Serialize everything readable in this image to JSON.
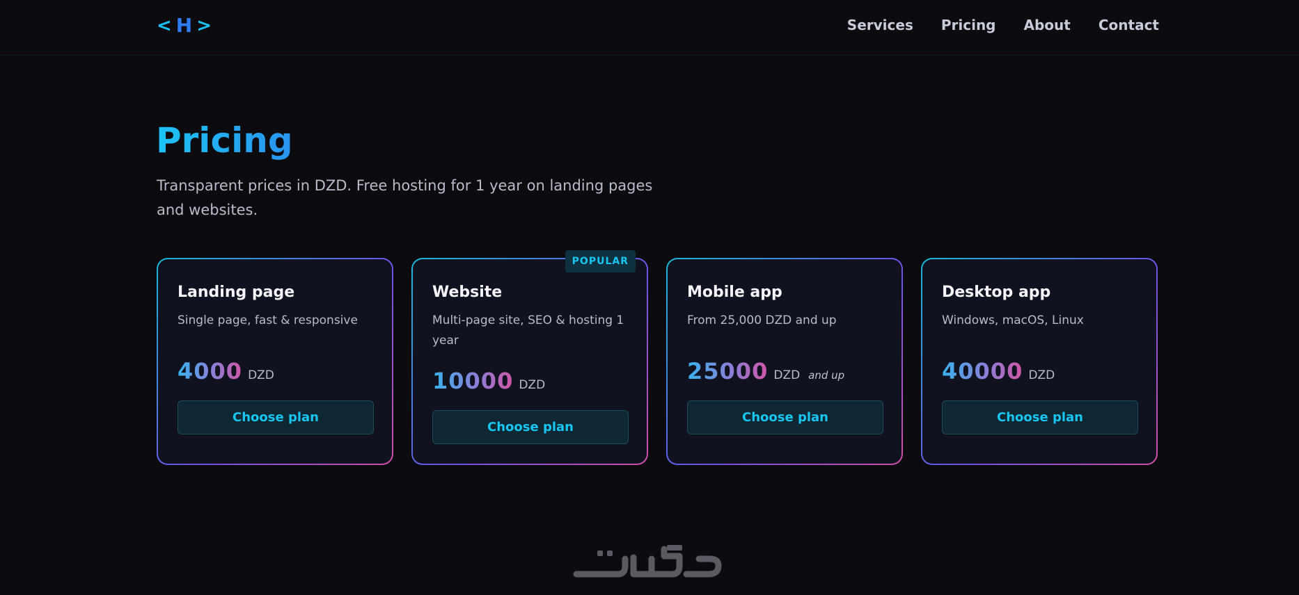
{
  "header": {
    "logo": {
      "left": "<",
      "letter": "H",
      "right": ">"
    },
    "nav": [
      "Services",
      "Pricing",
      "About",
      "Contact"
    ]
  },
  "hero": {
    "title": "Pricing",
    "subtitle": "Transparent prices in DZD. Free hosting for 1 year on landing pages and websites."
  },
  "plans": [
    {
      "title": "Landing page",
      "description": "Single page, fast & responsive",
      "price": "4000",
      "currency": "DZD",
      "suffix": "",
      "button": "Choose plan",
      "badge": ""
    },
    {
      "title": "Website",
      "description": "Multi-page site, SEO & hosting 1 year",
      "price": "10000",
      "currency": "DZD",
      "suffix": "",
      "button": "Choose plan",
      "badge": "POPULAR"
    },
    {
      "title": "Mobile app",
      "description": "From 25,000 DZD and up",
      "price": "25000",
      "currency": "DZD",
      "suffix": "and up",
      "button": "Choose plan",
      "badge": ""
    },
    {
      "title": "Desktop app",
      "description": "Windows, macOS, Linux",
      "price": "40000",
      "currency": "DZD",
      "suffix": "",
      "button": "Choose plan",
      "badge": ""
    }
  ],
  "footer": {
    "watermark_text": "خمسات"
  },
  "colors": {
    "background": "#0b0b10",
    "accent": "#19c6f2",
    "card_bg": "#101220"
  }
}
